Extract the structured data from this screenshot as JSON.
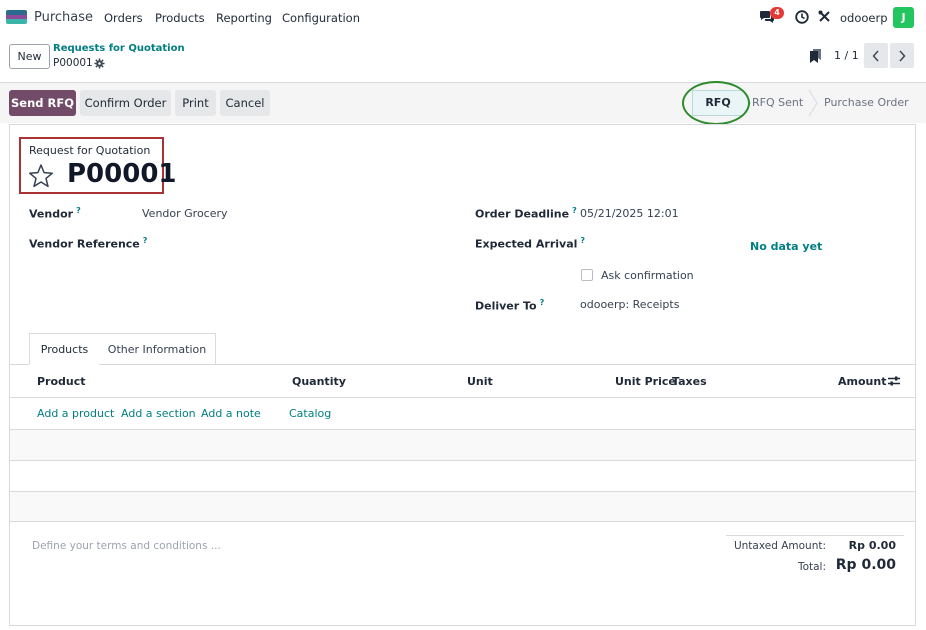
{
  "app": {
    "name": "Purchase",
    "icon": "purchase-app-icon",
    "menu": [
      "Orders",
      "Products",
      "Reporting",
      "Configuration"
    ],
    "notifications_count": "4",
    "db_name": "odooerp",
    "avatar_initial": "J"
  },
  "control_panel": {
    "new_label": "New",
    "breadcrumb": "Requests for Quotation",
    "record_name": "P00001",
    "pager": "1 / 1"
  },
  "actions": {
    "send_rfq": "Send RFQ",
    "confirm_order": "Confirm Order",
    "print": "Print",
    "cancel": "Cancel"
  },
  "statusbar": {
    "current": "RFQ",
    "stages": [
      "RFQ Sent",
      "Purchase Order"
    ]
  },
  "form": {
    "title_label": "Request for Quotation",
    "title": "P00001",
    "vendor_label": "Vendor",
    "vendor_value": "Vendor Grocery",
    "vendor_ref_label": "Vendor Reference",
    "order_deadline_label": "Order Deadline",
    "order_deadline_value": "05/21/2025 12:01",
    "expected_arrival_label": "Expected Arrival",
    "no_data": "No data yet",
    "ask_confirmation_label": "Ask confirmation",
    "deliver_to_label": "Deliver To",
    "deliver_to_value": "odooerp: Receipts",
    "help_mark": "?"
  },
  "tabs": [
    "Products",
    "Other Information"
  ],
  "table": {
    "headers": {
      "product": "Product",
      "quantity": "Quantity",
      "unit": "Unit",
      "unit_price": "Unit Price",
      "taxes": "Taxes",
      "amount": "Amount"
    },
    "links": [
      "Add a product",
      "Add a section",
      "Add a note",
      "Catalog"
    ]
  },
  "footer": {
    "terms_placeholder": "Define your terms and conditions ...",
    "untaxed_label": "Untaxed Amount:",
    "untaxed_value": "Rp 0.00",
    "total_label": "Total:",
    "total_value": "Rp 0.00"
  },
  "colors": {
    "primary": "#714b67",
    "link": "#017e84",
    "highlight_box": "#a93232",
    "highlight_ellipse": "#2e8b2e"
  }
}
